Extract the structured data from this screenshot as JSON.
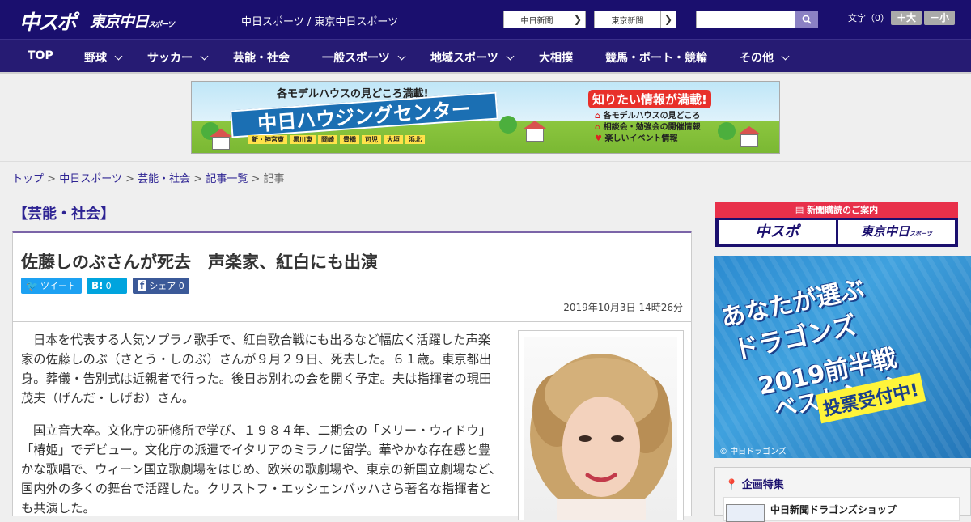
{
  "header": {
    "logo_chuspo": "中スポ",
    "logo_tokyo": "東京中日",
    "logo_tokyo_small": "スポーツ",
    "site_links": "中日スポーツ / 東京中日スポーツ",
    "paper_links": [
      {
        "label": "中日新聞",
        "arrow": "❯"
      },
      {
        "label": "東京新聞",
        "arrow": "❯"
      }
    ],
    "search_placeholder": "",
    "font_size_label": "文字（0）",
    "font_plus": "＋大",
    "font_minus": "－小"
  },
  "nav": {
    "items": [
      {
        "label": "TOP",
        "has_dropdown": false
      },
      {
        "label": "野球",
        "has_dropdown": true
      },
      {
        "label": "サッカー",
        "has_dropdown": true
      },
      {
        "label": "芸能・社会",
        "has_dropdown": false
      },
      {
        "label": "一般スポーツ",
        "has_dropdown": true
      },
      {
        "label": "地域スポーツ",
        "has_dropdown": true
      },
      {
        "label": "大相撲",
        "has_dropdown": false
      },
      {
        "label": "競馬・ボート・競輪",
        "has_dropdown": false
      },
      {
        "label": "その他",
        "has_dropdown": true
      }
    ]
  },
  "banner": {
    "top_text": "各モデルハウスの見どころ満載!",
    "main_text": "中日ハウジングセンター",
    "cities": [
      "新・神宮東",
      "黒川東",
      "岡崎",
      "豊橋",
      "可児",
      "大垣",
      "浜北"
    ],
    "right_head": "知りたい情報が満載!",
    "right_list": [
      "各モデルハウスの見どころ",
      "相談会・勉強会の開催情報",
      "楽しいイベント情報"
    ]
  },
  "breadcrumb": {
    "items": [
      "トップ",
      "中日スポーツ",
      "芸能・社会",
      "記事一覧"
    ],
    "current": "記事",
    "separator": ">"
  },
  "article": {
    "category": "【芸能・社会】",
    "title": "佐藤しのぶさんが死去　声楽家、紅白にも出演",
    "share": {
      "tweet": "ツイート",
      "hatena_icon": "B!",
      "hatena_count": "0",
      "facebook_icon": "f",
      "facebook_label": "シェア",
      "facebook_count": "0"
    },
    "date": "2019年10月3日 14時26分",
    "paragraphs": [
      "日本を代表する人気ソプラノ歌手で、紅白歌合戦にも出るなど幅広く活躍した声楽家の佐藤しのぶ（さとう・しのぶ）さんが９月２９日、死去した。６１歳。東京都出身。葬儀・告別式は近親者で行った。後日お別れの会を開く予定。夫は指揮者の現田茂夫（げんだ・しげお）さん。",
      "国立音大卒。文化庁の研修所で学び、１９８４年、二期会の「メリー・ウィドウ」「椿姫」でデビュー。文化庁の派遣でイタリアのミラノに留学。華やかな存在感と豊かな歌唱で、ウィーン国立歌劇場をはじめ、欧米の歌劇場や、東京の新国立劇場など、国内外の多くの舞台で活躍した。クリストフ・エッシェンバッハさら著名な指揮者とも共演した。"
    ]
  },
  "sidebar": {
    "subscribe_head": "新聞購読のご案内",
    "subscribe_logos": [
      "中スポ",
      "東京中日"
    ],
    "subscribe_logo_small": "スポーツ",
    "dragons_ad": {
      "lines": [
        "あなたが選ぶ",
        "ドラゴンズ",
        "2019前半戦",
        "ベストシーン"
      ],
      "vote": "投票受付中!",
      "copyright": "© 中日ドラゴンズ"
    },
    "feature": {
      "title": "企画特集",
      "item_title": "中日新聞ドラゴンズショップ"
    }
  },
  "colors": {
    "header_bg": "#1a0f6e",
    "nav_bg": "#261b73",
    "accent_link": "#2d2393",
    "twitter": "#1da1f2",
    "hatena": "#00a4de",
    "facebook": "#3b5998",
    "subscribe_red": "#e8304a"
  }
}
